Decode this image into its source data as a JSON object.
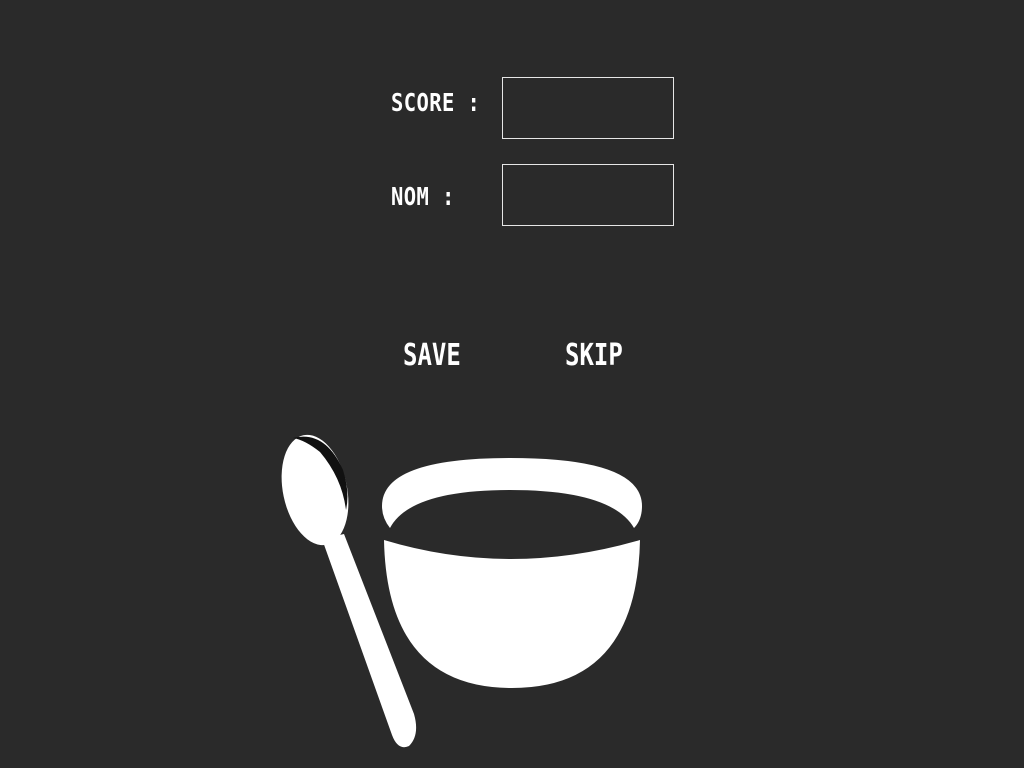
{
  "form": {
    "score_label": "SCORE :",
    "score_value": "",
    "name_label": "NOM :",
    "name_value": ""
  },
  "actions": {
    "save_label": "SAVE",
    "skip_label": "SKIP"
  },
  "illustration": {
    "icon": "bowl-and-spoon-icon",
    "color": "#ffffff"
  },
  "theme": {
    "background": "#2a2a2a",
    "foreground": "#ffffff"
  }
}
